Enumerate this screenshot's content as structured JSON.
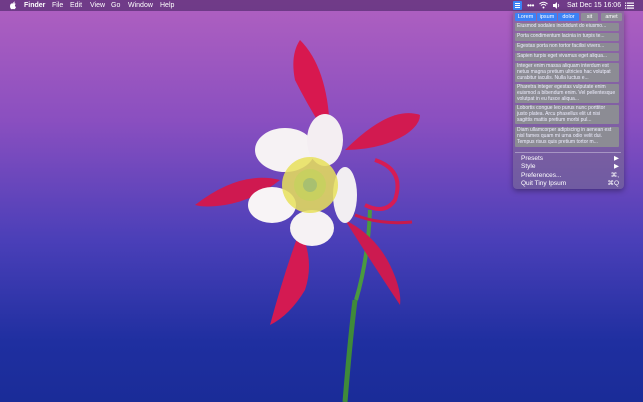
{
  "menubar": {
    "app_name": "Finder",
    "menus": [
      "File",
      "Edit",
      "View",
      "Go",
      "Window",
      "Help"
    ],
    "datetime": "Sat Dec 15  16:06",
    "icons": [
      "apple-icon",
      "tiny-ipsum-icon",
      "more-icon",
      "wifi-icon",
      "volume-icon",
      "list-icon"
    ]
  },
  "panel": {
    "tags": [
      {
        "label": "Lorem",
        "active": true
      },
      {
        "label": "ipsum",
        "active": true
      },
      {
        "label": "dolor",
        "active": true
      },
      {
        "label": "sit",
        "active": false
      },
      {
        "label": "amet",
        "active": false
      }
    ],
    "items": [
      "Eiusmod sodales incididunt do eiusmo...",
      "Porta condimentum lacinia in turpis te...",
      "Egestas porta non tortor facilisi vivers...",
      "Sapien turpis eget vivamus eget aliqua...",
      "Integer enim massa aliquam interdum est netus magna pretium ultricies hac volutpat curabitur iaculis. Nulla luctus e...",
      "Pharetra integer egestas vulputate enim euismod a bibendum enim. Vel pellentesque volutpat in eu fusce aliqua...",
      "Lobortis congue leo purus nunc porttitor justo platea. Arcu phasellus elit ut nisi sagittis mattis pretium morbi pul...",
      "Diam ullamcorper adipiscing in aenean est nisl fames quam mi urna odio velit dui. Tempus risus quis pretium tortor m..."
    ],
    "menu": [
      {
        "label": "Presets",
        "shortcut": "▶"
      },
      {
        "label": "Style",
        "shortcut": "▶"
      },
      {
        "label": "Preferences...",
        "shortcut": "⌘,"
      },
      {
        "label": "Quit Tiny Ipsum",
        "shortcut": "⌘Q"
      }
    ]
  }
}
